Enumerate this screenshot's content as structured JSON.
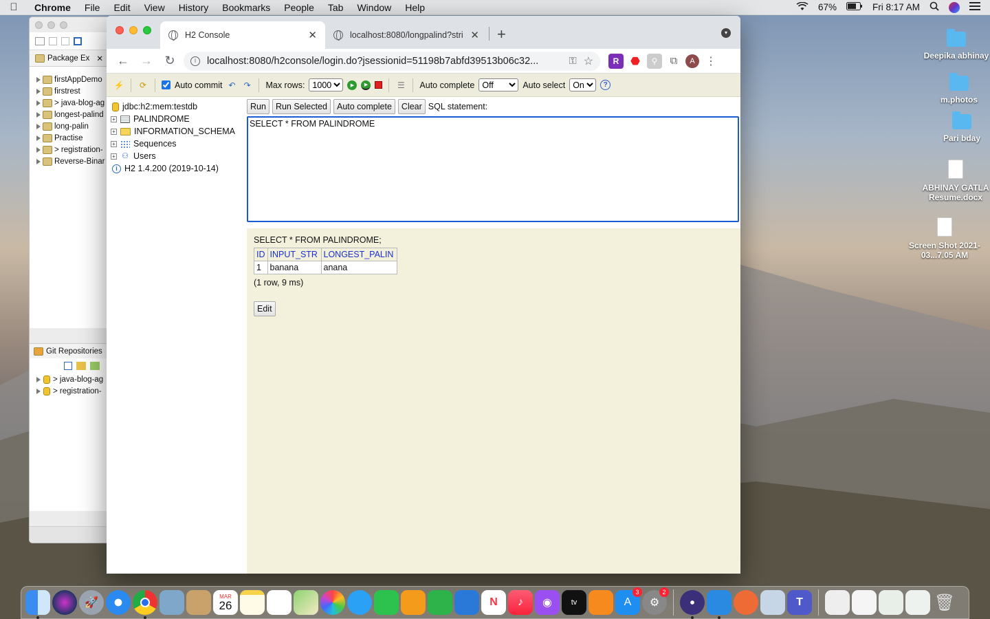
{
  "menubar": {
    "app": "Chrome",
    "items": [
      "File",
      "Edit",
      "View",
      "History",
      "Bookmarks",
      "People",
      "Tab",
      "Window",
      "Help"
    ],
    "battery": "67%",
    "clock": "Fri 8:17 AM"
  },
  "eclipse": {
    "package_explorer_label": "Package Ex",
    "projects": [
      "firstAppDemo",
      "firstrest",
      "> java-blog-ag",
      "longest-palind",
      "long-palin",
      "Practise",
      "> registration-",
      "Reverse-Binar"
    ],
    "git_label": "Git Repositories",
    "git_repos": [
      "> java-blog-ag",
      "> registration-"
    ]
  },
  "chrome": {
    "tabs": [
      {
        "title": "H2 Console",
        "active": true
      },
      {
        "title": "localhost:8080/longpalind?stri",
        "active": false
      }
    ],
    "url": "localhost:8080/h2console/login.do?jsessionid=51198b7abfd39513b06c32...",
    "avatar_letter": "A"
  },
  "h2": {
    "toolbar": {
      "auto_commit_label": "Auto commit",
      "auto_commit_checked": true,
      "max_rows_label": "Max rows:",
      "max_rows_value": "1000",
      "auto_complete_label": "Auto complete",
      "auto_complete_value": "Off",
      "auto_select_label": "Auto select",
      "auto_select_value": "On",
      "help_glyph": "?"
    },
    "tree": {
      "connection": "jdbc:h2:mem:testdb",
      "nodes": [
        "PALINDROME",
        "INFORMATION_SCHEMA",
        "Sequences",
        "Users"
      ],
      "version": "H2 1.4.200 (2019-10-14)"
    },
    "buttons": {
      "run": "Run",
      "run_selected": "Run Selected",
      "auto_complete": "Auto complete",
      "clear": "Clear"
    },
    "sql_statement_label": "SQL statement:",
    "sql_text": "SELECT * FROM PALINDROME ",
    "result": {
      "query": "SELECT * FROM PALINDROME;",
      "columns": [
        "ID",
        "INPUT_STR",
        "LONGEST_PALIN"
      ],
      "rows": [
        [
          "1",
          "banana",
          "anana"
        ]
      ],
      "meta": "(1 row, 9 ms)",
      "edit_label": "Edit"
    }
  },
  "desktop": {
    "icons": [
      "Deepika abhinay",
      "m.photos",
      "Pari bday",
      "ABHINAY GATLA Resume.docx",
      "Screen Shot 2021-03...7.05 AM"
    ]
  },
  "dock": {
    "calendar_month": "MAR",
    "calendar_day": "26",
    "appstore_badge": "3",
    "settings_badge": "2"
  }
}
